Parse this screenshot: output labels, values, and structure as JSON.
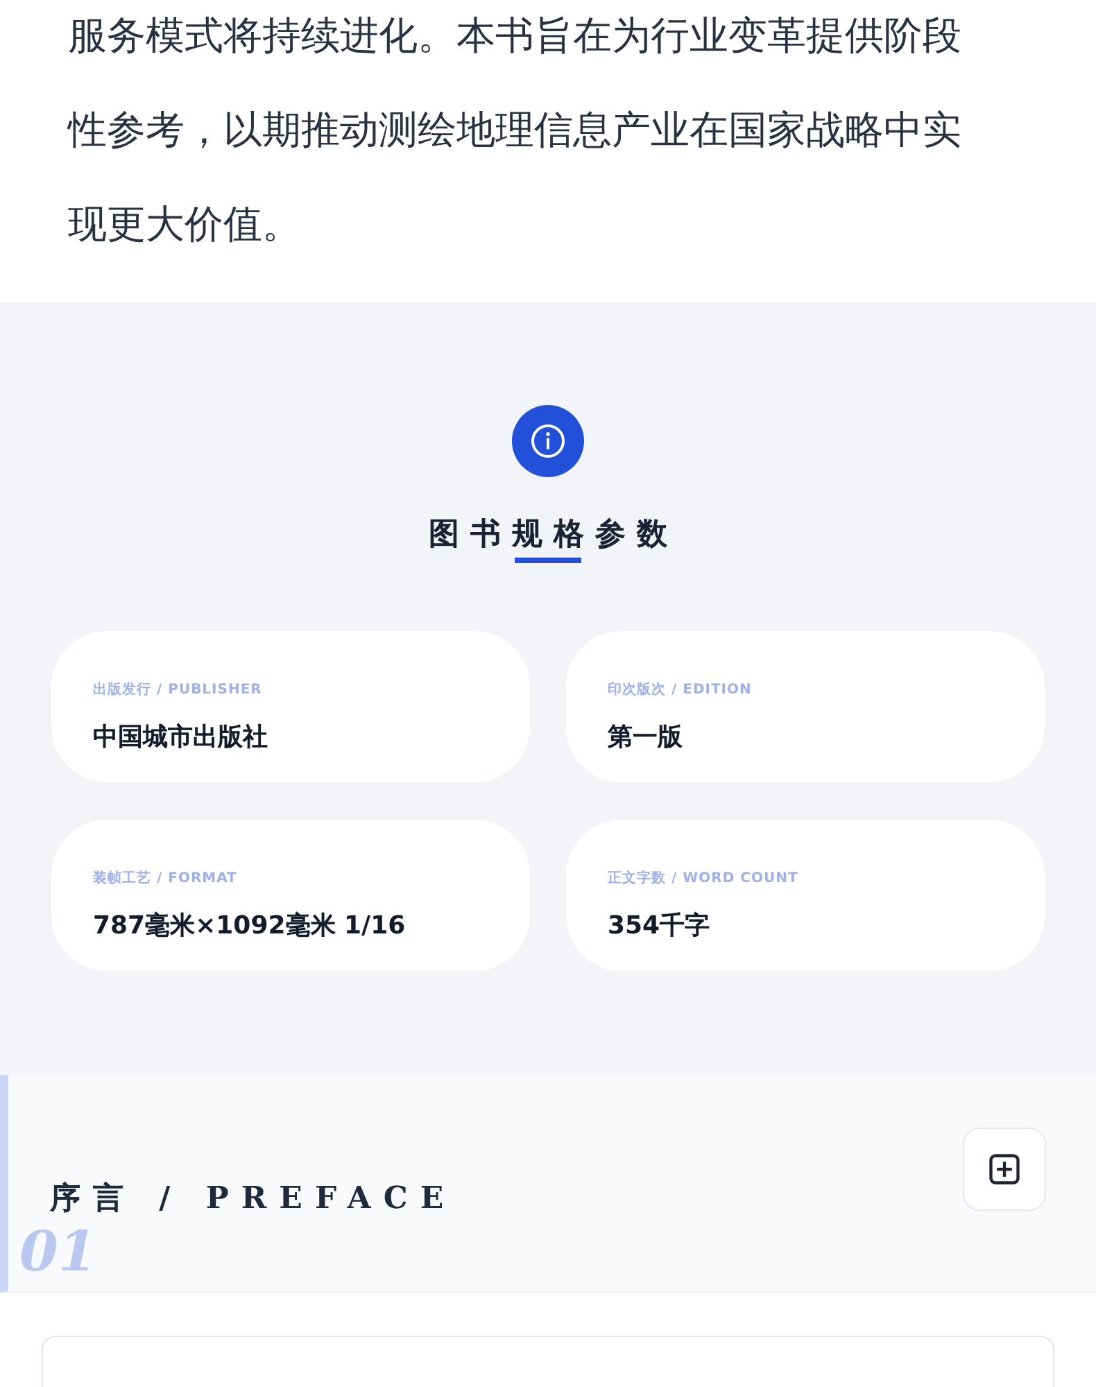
{
  "intro": {
    "text": "服务模式将持续进化。本书旨在为行业变革提供阶段性参考，以期推动测绘地理信息产业在国家战略中实现更大价值。"
  },
  "specs": {
    "title": "图书规格参数",
    "items": [
      {
        "label": "出版发行 / PUBLISHER",
        "value": "中国城市出版社"
      },
      {
        "label": "印次版次 / EDITION",
        "value": "第一版"
      },
      {
        "label": "装帧工艺 / FORMAT",
        "value": "787毫米×1092毫米 1/16"
      },
      {
        "label": "正文字数 / WORD COUNT",
        "value": "354千字"
      }
    ]
  },
  "preface": {
    "number": "01",
    "title": "序言 / PREFACE",
    "expanded": false
  }
}
